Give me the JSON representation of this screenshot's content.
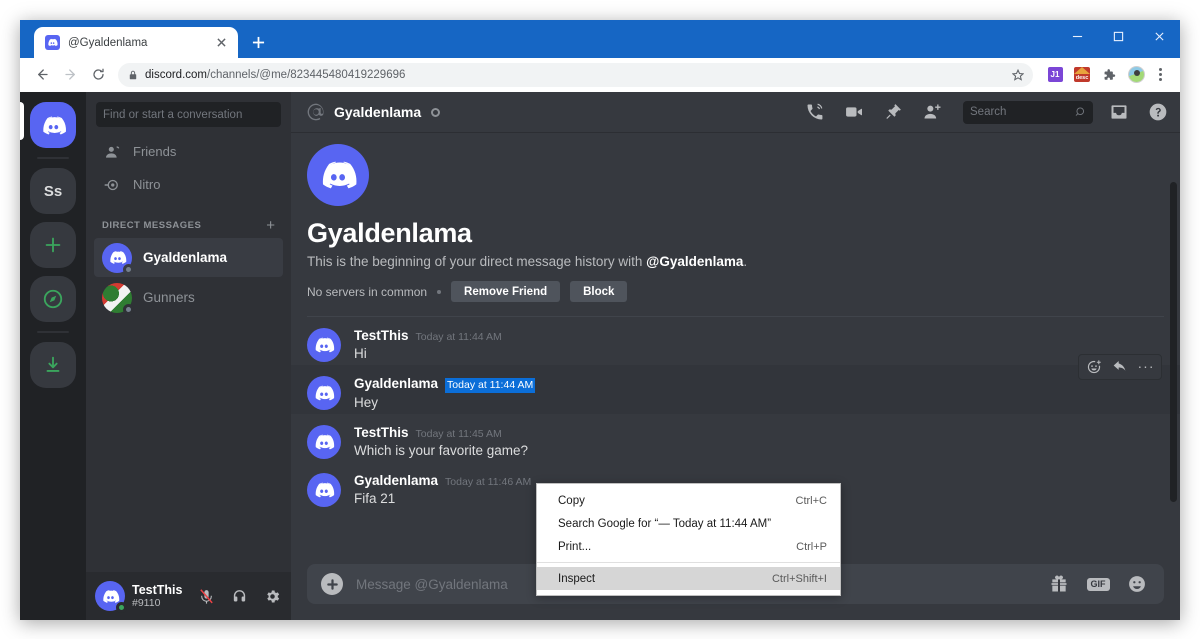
{
  "browser": {
    "tab": {
      "title": "@Gyaldenlama",
      "favicon": "discord-icon",
      "close": "close-icon"
    },
    "new_tab_label": "+",
    "window_controls": {
      "minimize": "minimize-icon",
      "maximize": "maximize-icon",
      "close": "close-icon"
    },
    "nav": {
      "back": "back-arrow-icon",
      "forward": "forward-arrow-icon",
      "reload": "reload-icon"
    },
    "omnibox": {
      "lock": "lock-icon",
      "url_domain": "discord.com",
      "url_path": "/channels/@me/823445480419229696",
      "star": "star-icon"
    },
    "extensions": [
      {
        "name": "j1-extension-icon",
        "label": "J1"
      },
      {
        "name": "desc-extension-icon",
        "label": "desc"
      },
      {
        "name": "extensions-puzzle-icon",
        "label": ""
      }
    ],
    "profile": "profile-avatar",
    "menu": "three-dot-menu-icon",
    "accent_color": "#1666c4"
  },
  "discord": {
    "rail": [
      {
        "name": "home-button",
        "label": "",
        "icon": "discord-logo-icon",
        "active": true
      },
      {
        "name": "server-ss",
        "label": "Ss",
        "icon": "",
        "active": false
      },
      {
        "name": "add-server-button",
        "label": "",
        "icon": "plus-icon",
        "active": false
      },
      {
        "name": "explore-servers-button",
        "label": "",
        "icon": "compass-icon",
        "active": false
      },
      {
        "name": "download-apps-button",
        "label": "",
        "icon": "download-icon",
        "active": false
      }
    ],
    "sidebar": {
      "search_placeholder": "Find or start a conversation",
      "nav": [
        {
          "label": "Friends",
          "icon": "friends-icon"
        },
        {
          "label": "Nitro",
          "icon": "nitro-icon"
        }
      ],
      "section_header": "DIRECT MESSAGES",
      "section_add": "+",
      "dms": [
        {
          "name": "Gyaldenlama",
          "avatar": "discord",
          "status": "offline",
          "active": true
        },
        {
          "name": "Gunners",
          "avatar": "gunners",
          "status": "offline",
          "active": false
        }
      ]
    },
    "user_panel": {
      "username": "TestThis",
      "tag": "#9110",
      "status": "online",
      "buttons": [
        {
          "name": "mute-microphone-button",
          "icon": "microphone-muted-icon"
        },
        {
          "name": "deafen-button",
          "icon": "headphones-icon"
        },
        {
          "name": "user-settings-button",
          "icon": "gear-icon"
        }
      ]
    },
    "header": {
      "at_icon": "at-sign-icon",
      "title": "Gyaldenlama",
      "status": "offline",
      "icons": [
        {
          "name": "start-voice-call-button",
          "icon": "phone-call-icon"
        },
        {
          "name": "start-video-call-button",
          "icon": "video-camera-icon"
        },
        {
          "name": "pinned-messages-button",
          "icon": "pin-icon"
        },
        {
          "name": "add-friends-to-dm-button",
          "icon": "add-person-icon"
        }
      ],
      "search_placeholder": "Search",
      "search_icon": "search-icon",
      "inbox": "inbox-icon",
      "help": "help-circle-icon"
    },
    "welcome": {
      "avatar": "discord-default-avatar",
      "title": "Gyaldenlama",
      "subtitle_pre": "This is the beginning of your direct message history with ",
      "subtitle_mention": "@Gyaldenlama",
      "subtitle_post": ".",
      "no_servers": "No servers in common",
      "remove_friend_label": "Remove Friend",
      "block_label": "Block"
    },
    "messages": [
      {
        "author": "TestThis",
        "timestamp": "Today at 11:44 AM",
        "text": "Hi",
        "timestamp_selected": false,
        "hovered": false
      },
      {
        "author": "Gyaldenlama",
        "timestamp": "Today at 11:44 AM",
        "text": "Hey",
        "timestamp_selected": true,
        "hovered": true
      },
      {
        "author": "TestThis",
        "timestamp": "Today at 11:45 AM",
        "text": "Which is your favorite game?",
        "timestamp_selected": false,
        "hovered": false
      },
      {
        "author": "Gyaldenlama",
        "timestamp": "Today at 11:46 AM",
        "text": "Fifa 21",
        "timestamp_selected": false,
        "hovered": false
      }
    ],
    "message_actions": [
      {
        "name": "add-reaction-button",
        "icon": "add-reaction-icon"
      },
      {
        "name": "reply-button",
        "icon": "reply-arrow-icon"
      },
      {
        "name": "more-options-button",
        "icon": "ellipsis-icon"
      }
    ],
    "composer": {
      "attach_icon": "plus-circle-icon",
      "placeholder": "Message @Gyaldenlama",
      "buttons": [
        {
          "name": "gift-nitro-button",
          "icon": "gift-icon",
          "label": ""
        },
        {
          "name": "gif-picker-button",
          "icon": "gif-badge",
          "label": "GIF"
        },
        {
          "name": "emoji-picker-button",
          "icon": "emoji-smiley-icon",
          "label": ""
        }
      ]
    },
    "colors": {
      "brand": "#5865f2",
      "rail_bg": "#202225",
      "sidebar_bg": "#2f3136",
      "chat_bg": "#36393f",
      "online": "#3ba55d",
      "offline": "#747f8d",
      "selection": "#0b6ed8"
    }
  },
  "context_menu": {
    "items": [
      {
        "label": "Copy",
        "accelerator": "Ctrl+C",
        "highlight": false,
        "separator_after": false
      },
      {
        "label": "Search Google for “— Today at 11:44 AM”",
        "accelerator": "",
        "highlight": false,
        "separator_after": false
      },
      {
        "label": "Print...",
        "accelerator": "Ctrl+P",
        "highlight": false,
        "separator_after": true
      },
      {
        "label": "Inspect",
        "accelerator": "Ctrl+Shift+I",
        "highlight": true,
        "separator_after": false
      }
    ]
  }
}
